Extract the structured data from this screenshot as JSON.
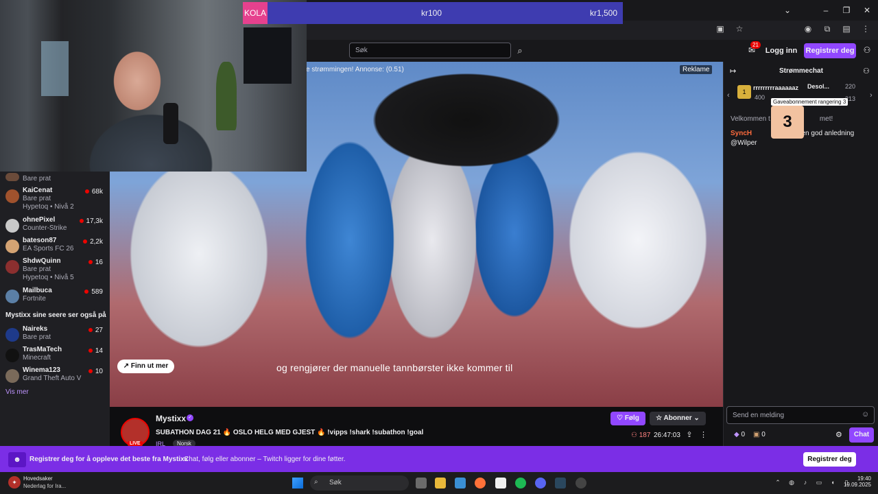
{
  "goal": {
    "label": "KOLA",
    "current": "kr100",
    "target": "kr1,500",
    "progress_fraction": 0.07
  },
  "nav": {
    "search_placeholder": "Søk",
    "notification_count": "21",
    "login": "Logg inn",
    "register": "Registrer deg"
  },
  "sidebar": {
    "channels": [
      {
        "category": "Bare prat"
      },
      {
        "name": "KaiCenat",
        "category": "Bare prat",
        "sub": "Hypetoq • Nivå 2",
        "viewers": "68k"
      },
      {
        "name": "ohnePixel",
        "category": "Counter-Strike",
        "viewers": "17,3k"
      },
      {
        "name": "bateson87",
        "category": "EA Sports FC 26",
        "viewers": "2,2k"
      },
      {
        "name": "ShdwQuinn",
        "category": "Bare prat",
        "sub": "Hypetoq • Nivå 5",
        "viewers": "16"
      },
      {
        "name": "Mailbuca",
        "category": "Fortnite",
        "viewers": "589"
      }
    ],
    "also_watch_heading": "Mystixx sine seere ser også på",
    "also_watch": [
      {
        "name": "Naireks",
        "category": "Bare prat",
        "viewers": "27"
      },
      {
        "name": "TrasMaTech",
        "category": "Minecraft",
        "viewers": "14"
      },
      {
        "name": "Winema123",
        "category": "Grand Theft Auto V",
        "viewers": "10"
      }
    ],
    "see_more": "Vis mer"
  },
  "video": {
    "ad_text": "e strømmingen! Annonse: (0.51)",
    "ad_badge": "Reklame",
    "find_out_more": "Finn ut mer",
    "subtitle": "og rengjører der manuelle tannbørster ikke kommer til"
  },
  "stream": {
    "streamer": "Mystixx",
    "live_badge": "LIVE",
    "title": "SUBATHON DAG 21 🔥 OSLO HELG MED GJEST 🔥 !vipps !shark !subathon !goal",
    "category": "IRL",
    "language_tag": "Norsk",
    "follow": "Følg",
    "subscribe": "Abonner",
    "viewers": "187",
    "uptime": "26:47:03"
  },
  "chat": {
    "title": "Strømmechat",
    "leaderboard": {
      "gift_rank": "1",
      "top_gifter": "rrrrrrrrraaaaaaz",
      "top_gifter_value": "400",
      "second_name": "Desol...",
      "second_value": "220",
      "third_value": "213",
      "tooltip": "Gaveabonnement rangering 3",
      "gift_badge": "3"
    },
    "welcome": "Velkommen t",
    "welcome_end": "met!",
    "message_user": "SyncH",
    "message_text": "eg er en god anledning @Wilper",
    "input_placeholder": "Send en melding",
    "points_a": "0",
    "points_b": "0",
    "chat_button": "Chat"
  },
  "banner": {
    "headline": "Registrer deg for å oppleve det beste fra Mystixx",
    "text": "Chat, følg eller abonner – Twitch ligger for dine føtter.",
    "button": "Registrer deg"
  },
  "taskbar": {
    "news_title": "Hovedsaker",
    "news_sub": "Nederlag for Ira...",
    "search": "Søk",
    "time": "19:40",
    "date": "19.09.2025"
  },
  "colors": {
    "twitch_purple": "#9147ff",
    "live_red": "#eb0400",
    "goal_pink": "#e6418e",
    "goal_blue": "#3e3cb0"
  }
}
